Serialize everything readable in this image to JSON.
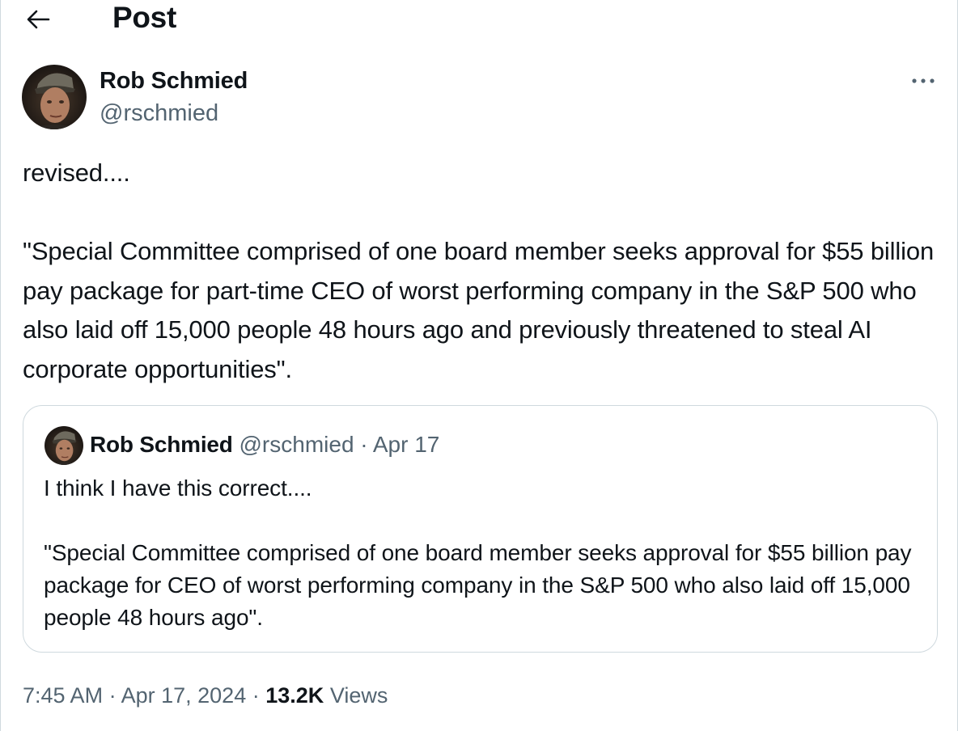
{
  "header": {
    "title": "Post",
    "back_icon": "arrow-left-icon"
  },
  "tweet": {
    "author_name": "Rob Schmied",
    "author_handle": "@rschmied",
    "more_icon": "more-horizontal-icon",
    "text": "revised....\n\n\"Special Committee comprised of one board member seeks approval for $55 billion pay package for part-time CEO of worst performing company in the S&P 500 who also laid off 15,000 people 48 hours ago and previously threatened to steal AI corporate opportunities\".",
    "time": "7:45 AM",
    "date": "Apr 17, 2024",
    "views_count": "13.2K",
    "views_label": "Views",
    "separator": "·"
  },
  "quoted_tweet": {
    "author_name": "Rob Schmied",
    "author_handle": "@rschmied",
    "date": "Apr 17",
    "separator": "·",
    "text": "I think I have this correct....\n\n\"Special Committee comprised of one board member seeks approval for $55 billion pay package for CEO of worst performing company in the S&P 500 who also laid off 15,000 people 48 hours ago\"."
  },
  "colors": {
    "text_primary": "#0f1419",
    "text_secondary": "#536471",
    "border": "#cfd9de"
  }
}
